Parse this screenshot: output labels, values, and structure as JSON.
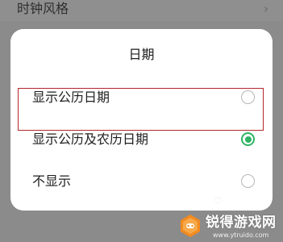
{
  "background": {
    "setting_title": "时钟风格",
    "chevron": "›"
  },
  "dialog": {
    "title": "日期",
    "options": [
      {
        "label": "显示公历日期",
        "selected": false
      },
      {
        "label": "显示公历及农历日期",
        "selected": true
      },
      {
        "label": "不显示",
        "selected": false
      }
    ]
  },
  "watermark": {
    "text": "锐得游戏网",
    "url": "www.ytruido.com"
  },
  "colors": {
    "accent": "#2fb464",
    "highlight_border": "#b3262b",
    "watermark_orange": "#f28a1f"
  }
}
